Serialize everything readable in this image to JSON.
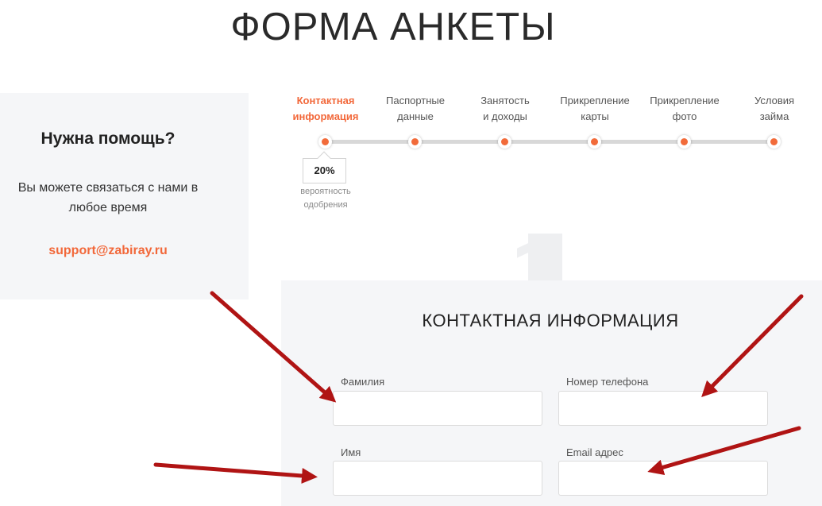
{
  "page": {
    "title": "ФОРМА АНКЕТЫ"
  },
  "help": {
    "title": "Нужна помощь?",
    "text": "Вы можете связаться с нами в любое время",
    "email": "support@zabiray.ru"
  },
  "steps": {
    "items": [
      {
        "label": "Контактная\nинформация",
        "active": true
      },
      {
        "label": "Паспортные\nданные",
        "active": false
      },
      {
        "label": "Занятость\nи доходы",
        "active": false
      },
      {
        "label": "Прикрепление\nкарты",
        "active": false
      },
      {
        "label": "Прикрепление\nфото",
        "active": false
      },
      {
        "label": "Условия\nзайма",
        "active": false
      }
    ],
    "progress_value": "20%",
    "progress_caption": "вероятность\nодобрения"
  },
  "form": {
    "title": "КОНТАКТНАЯ ИНФОРМАЦИЯ",
    "fields": {
      "last_name": {
        "label": "Фамилия",
        "value": ""
      },
      "phone": {
        "label": "Номер телефона",
        "value": ""
      },
      "first_name": {
        "label": "Имя",
        "value": ""
      },
      "email": {
        "label": "Email адрес",
        "value": ""
      }
    }
  },
  "colors": {
    "accent": "#f2683a",
    "annotation_arrow": "#b01414",
    "card_bg": "#f5f6f8"
  },
  "annotations": {
    "arrow_icon": "arrow-annotation-icon",
    "count": 4
  }
}
